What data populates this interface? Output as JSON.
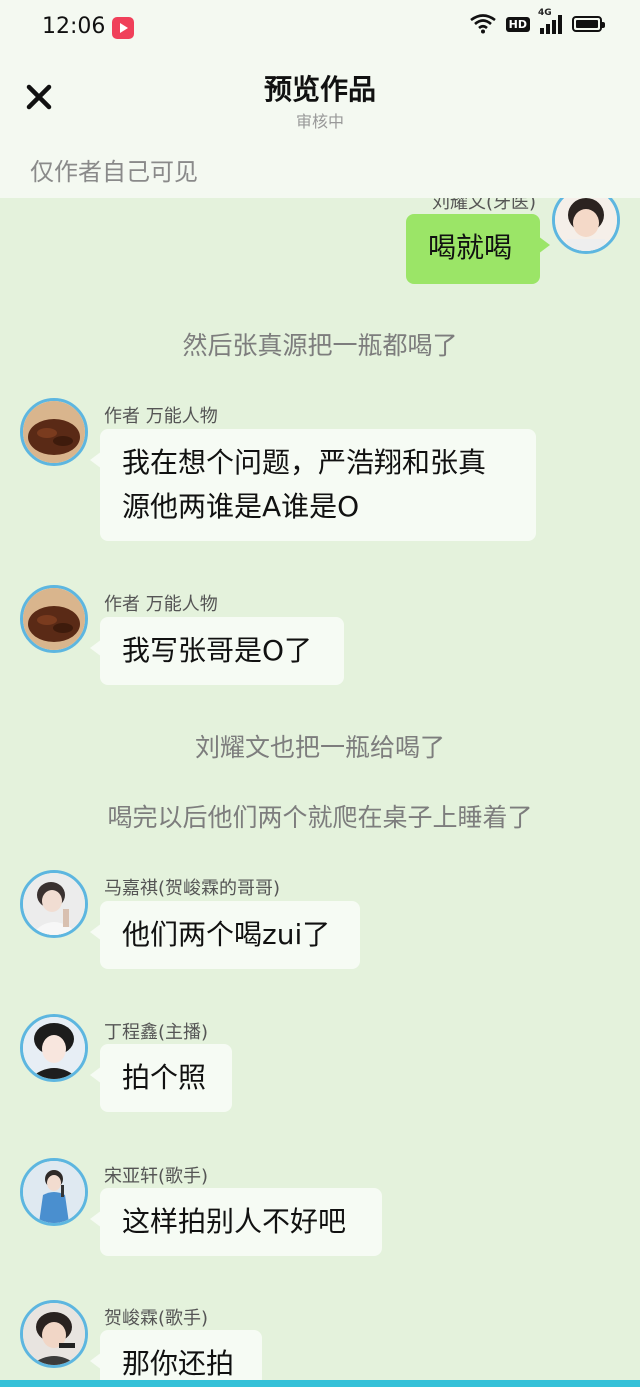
{
  "status_bar": {
    "time": "12:06",
    "network_label": "4G",
    "hd_label": "HD"
  },
  "header": {
    "title": "预览作品",
    "subtitle": "审核中",
    "privacy_note": "仅作者自己可见"
  },
  "messages": [
    {
      "type": "right",
      "name": "刘耀文(牙医)",
      "text": "喝就喝"
    },
    {
      "type": "narration",
      "text": "然后张真源把一瓶都喝了"
    },
    {
      "type": "left",
      "name": "作者 万能人物",
      "lines": [
        "我在想个问题，严浩翔和张真",
        "源他两谁是A谁是O"
      ]
    },
    {
      "type": "left",
      "name": "作者 万能人物",
      "text": "我写张哥是O了"
    },
    {
      "type": "narration",
      "text": "刘耀文也把一瓶给喝了"
    },
    {
      "type": "narration",
      "text": "喝完以后他们两个就爬在桌子上睡着了"
    },
    {
      "type": "left",
      "name": "马嘉祺(贺峻霖的哥哥)",
      "text": "他们两个喝zui了"
    },
    {
      "type": "left",
      "name": "丁程鑫(主播)",
      "text": "拍个照"
    },
    {
      "type": "left",
      "name": "宋亚轩(歌手)",
      "text": "这样拍别人不好吧"
    },
    {
      "type": "left",
      "name": "贺峻霖(歌手)",
      "text": "那你还拍"
    }
  ],
  "colors": {
    "accent_avatar_border": "#5db6e0",
    "my_bubble": "#9be567",
    "background": "#e4f2dc"
  }
}
